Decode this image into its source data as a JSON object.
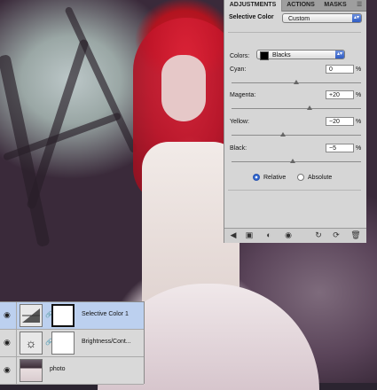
{
  "adjustments_panel": {
    "tabs": [
      "ADJUSTMENTS",
      "ACTIONS",
      "MASKS"
    ],
    "menu_icon": "panel-menu-icon",
    "title": "Selective Color",
    "preset_value": "Custom",
    "colors_label": "Colors:",
    "colors_value": "Blacks",
    "colors_swatch": "#000000",
    "sliders": [
      {
        "label": "Cyan:",
        "value": "0",
        "unit": "%",
        "position": 0.5
      },
      {
        "label": "Magenta:",
        "value": "+20",
        "unit": "%",
        "position": 0.6
      },
      {
        "label": "Yellow:",
        "value": "−20",
        "unit": "%",
        "position": 0.4
      },
      {
        "label": "Black:",
        "value": "−5",
        "unit": "%",
        "position": 0.475
      }
    ],
    "method": {
      "relative_label": "Relative",
      "absolute_label": "Absolute",
      "selected": "Relative"
    },
    "toolbar_icons": [
      "back-icon",
      "expand-view-icon",
      "clip-layer-icon",
      "visibility-icon",
      "view-previous-icon",
      "reset-icon",
      "delete-icon"
    ]
  },
  "layers_panel": {
    "layers": [
      {
        "name": "Selective Color 1",
        "selected": true,
        "type": "adjustment"
      },
      {
        "name": "Brightness/Cont...",
        "selected": false,
        "type": "adjustment"
      },
      {
        "name": "photo",
        "selected": false,
        "type": "image"
      }
    ]
  },
  "colors": {
    "panel_bg": "#d6d6d6",
    "selected_layer": "#bcd0ef",
    "accent_blue": "#2e5bc4"
  }
}
